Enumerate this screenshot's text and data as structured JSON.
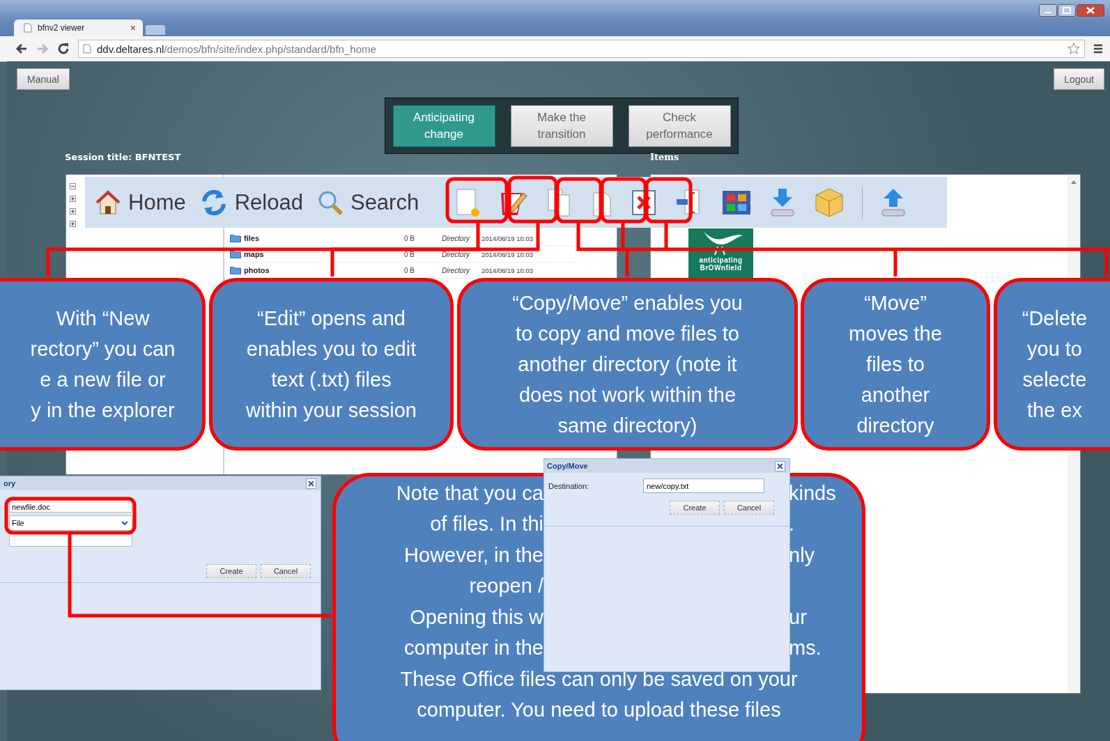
{
  "browser": {
    "tab_title": "bfnv2 viewer",
    "tab_close": "×",
    "url_host": "ddv.deltares.nl",
    "url_path": "/demos/bfn/site/index.php/standard/bfn_home"
  },
  "header": {
    "manual_button": "Manual",
    "logout_button": "Logout"
  },
  "steps": [
    {
      "label": "Anticipating change",
      "selected": true
    },
    {
      "label": "Make the transition",
      "selected": false
    },
    {
      "label": "Check performance",
      "selected": false
    }
  ],
  "session_title": "Session title: BFNTEST",
  "items_title": "Items",
  "toolbar": {
    "buttons": [
      {
        "label": "Home",
        "kind": "home"
      },
      {
        "label": "Reload",
        "kind": "reload"
      },
      {
        "label": "Search",
        "kind": "search"
      }
    ]
  },
  "files": [
    {
      "name": "files",
      "size": "0 B",
      "type": "Directory",
      "date": "2014/08/19 10:03"
    },
    {
      "name": "maps",
      "size": "0 B",
      "type": "Directory",
      "date": "2014/08/19 10:03"
    },
    {
      "name": "photos",
      "size": "0 B",
      "type": "Directory",
      "date": "2014/08/19 10:03"
    }
  ],
  "logo_text": "anticipating\nBrOWnfield",
  "callouts": [
    {
      "text": "With “New\nrectory” you can\ne a new file or\ny  in the explorer"
    },
    {
      "text": "“Edit” opens and\nenables you to edit\ntext (.txt) files\nwithin your session"
    },
    {
      "text": "“Copy/Move” enables you\nto copy and move files to\nanother directory (note it\ndoes not work within the\nsame directory)"
    },
    {
      "text": "“Move”\nmoves the\nfiles to\nanother\ndirectory"
    },
    {
      "text": "“Delete\nyou to\nselecte\nthe ex"
    }
  ],
  "note": {
    "lines": [
      {
        "left": "Note that you ca",
        "right": "kinds"
      },
      {
        "left": "of files. In thi",
        "right": "."
      },
      {
        "left": "However, in the",
        "right": "nly"
      },
      {
        "left": "reopen /"
      },
      {
        "left": "Opening this w",
        "right": "ur"
      },
      {
        "left": "computer in the",
        "right": "ms."
      },
      {
        "full": "These Office files can only be saved on your"
      },
      {
        "full": "computer. You need to upload these files"
      }
    ]
  },
  "new_dialog": {
    "title": "ory",
    "name_value": "newfile.doc",
    "type_value": "File",
    "create": "Create",
    "cancel": "Cancel"
  },
  "copy_dialog": {
    "title": "Copy/Move",
    "label": "Destination:",
    "value": "new/copy.txt",
    "create": "Create",
    "cancel": "Cancel"
  }
}
